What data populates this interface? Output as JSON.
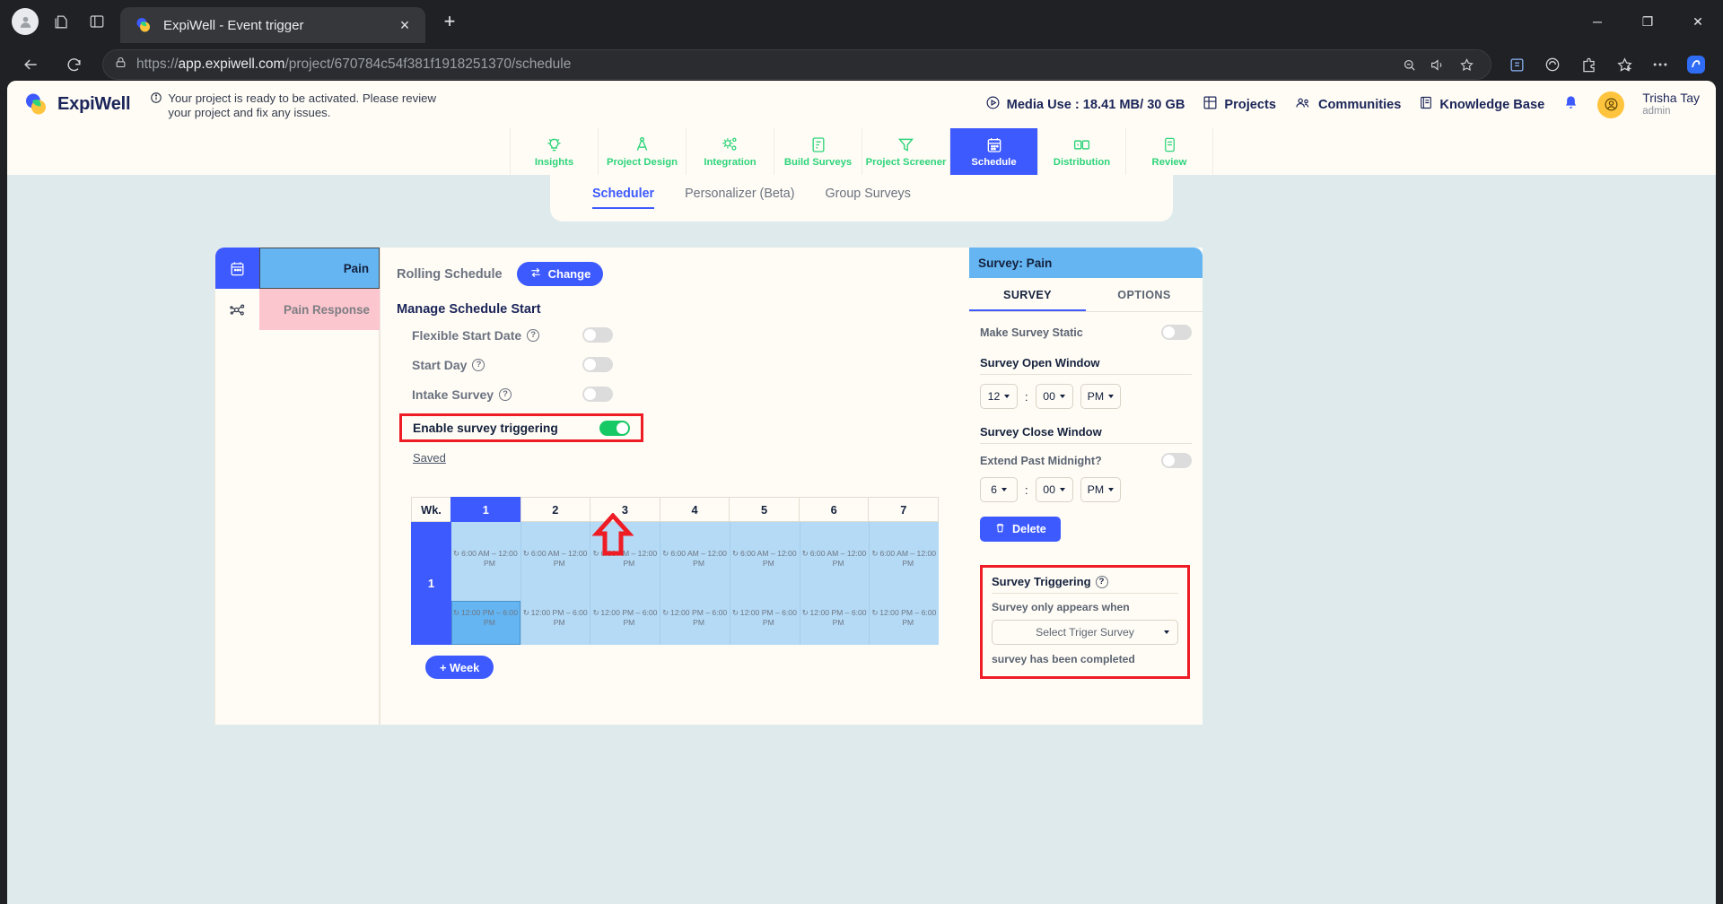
{
  "browser": {
    "tab_title": "ExpiWell - Event trigger",
    "url_bold": "app.expiwell.com",
    "url_prefix": "https://",
    "url_rest": "/project/670784c54f381f1918251370/schedule",
    "new_tab_label": "+",
    "close_tab_label": "×",
    "minimize_label": "─",
    "maximize_label": "❐",
    "close_label": "✕"
  },
  "header": {
    "logo_text": "ExpiWell",
    "banner": "Your project is ready to be activated. Please review your project and fix any issues.",
    "media_use": "Media Use : 18.41 MB/ 30 GB",
    "projects": "Projects",
    "communities": "Communities",
    "knowledge_base": "Knowledge Base",
    "user_name": "Trisha Tay",
    "user_role": "admin"
  },
  "modules": [
    {
      "label": "Insights",
      "icon": "lightbulb-icon",
      "active": false
    },
    {
      "label": "Project Design",
      "icon": "compass-icon",
      "active": false
    },
    {
      "label": "Integration",
      "icon": "gears-icon",
      "active": false
    },
    {
      "label": "Build Surveys",
      "icon": "document-icon",
      "active": false
    },
    {
      "label": "Project Screener",
      "icon": "funnel-icon",
      "active": false
    },
    {
      "label": "Schedule",
      "icon": "calendar-icon",
      "active": true
    },
    {
      "label": "Distribution",
      "icon": "distribution-icon",
      "active": false
    },
    {
      "label": "Review",
      "icon": "review-icon",
      "active": false
    }
  ],
  "subtabs": [
    {
      "label": "Scheduler",
      "active": true
    },
    {
      "label": "Personalizer (Beta)",
      "active": false
    },
    {
      "label": "Group Surveys",
      "active": false
    }
  ],
  "survey_list": [
    {
      "label": "Pain",
      "state": "selected"
    },
    {
      "label": "Pain Response",
      "state": "alt"
    }
  ],
  "scheduler": {
    "rolling_label": "Rolling Schedule",
    "change_button": "Change",
    "section_title": "Manage Schedule Start",
    "options": [
      {
        "label": "Flexible Start Date",
        "help": "?",
        "on": false
      },
      {
        "label": "Start Day",
        "help": "?",
        "on": false
      },
      {
        "label": "Intake Survey",
        "help": "?",
        "on": false
      }
    ],
    "trigger_option": {
      "label": "Enable survey triggering",
      "on": true
    },
    "saved_link": "Saved",
    "add_week_button": "+ Week"
  },
  "calendar": {
    "week_header": "Wk.",
    "days": [
      "1",
      "2",
      "3",
      "4",
      "5",
      "6",
      "7"
    ],
    "active_day": "1",
    "weeks": [
      {
        "label": "1",
        "slots_morning": "6:00 AM – 12:00 PM",
        "slots_evening": "12:00 PM – 6:00 PM",
        "selected_day_index": 0
      }
    ]
  },
  "right_panel": {
    "title": "Survey: Pain",
    "tabs": [
      {
        "label": "SURVEY",
        "active": true
      },
      {
        "label": "OPTIONS",
        "active": false
      }
    ],
    "make_static_label": "Make Survey Static",
    "make_static_on": false,
    "open_window_title": "Survey Open Window",
    "open_hour": "12",
    "open_minute": "00",
    "open_meridiem": "PM",
    "close_window_title": "Survey Close Window",
    "extend_midnight_label": "Extend Past Midnight?",
    "extend_midnight_on": false,
    "close_hour": "6",
    "close_minute": "00",
    "close_meridiem": "PM",
    "delete_button": "Delete",
    "trigger_title": "Survey Triggering",
    "trigger_help": "?",
    "trigger_rule_prefix": "Survey only appears when",
    "trigger_select_placeholder": "Select Triger Survey",
    "trigger_rule_suffix": "survey has been completed",
    "time_separator": ":"
  },
  "colors": {
    "accent_blue": "#3d5afe",
    "green": "#2ed47a",
    "toggle_on": "#17c964",
    "highlight_red": "#ee1c25",
    "survey_blue": "#64b5f2",
    "survey_pink": "#fbc6cd"
  }
}
